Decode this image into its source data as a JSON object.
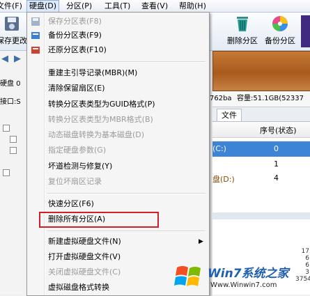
{
  "menubar": {
    "items": [
      {
        "label": "文件(F)"
      },
      {
        "label": "硬盘(D)"
      },
      {
        "label": "分区(P)"
      },
      {
        "label": "工具(T)"
      },
      {
        "label": "查看(V)"
      },
      {
        "label": "帮助(H)"
      }
    ]
  },
  "toolbar": {
    "save_label": "保存更改",
    "delete_partition_label": "删除分区",
    "backup_partition_label": "备份分区"
  },
  "left_panel": {
    "disk_label": "硬盘 0",
    "interface_label": "接口:S"
  },
  "disk_info": {
    "text": "762ba",
    "capacity": "容量:51.1GB(52337"
  },
  "tabs": {
    "file_tab": "文件"
  },
  "table": {
    "headers": {
      "serial": "序号(状态)"
    },
    "rows": [
      {
        "name": "(C:)",
        "serial": "0"
      },
      {
        "name": "",
        "serial": "1"
      },
      {
        "name": "盘(D:)",
        "serial": "4"
      }
    ]
  },
  "menu": {
    "items": [
      {
        "label": "保存分区表(F8)",
        "disabled": true
      },
      {
        "label": "备份分区表(F9)",
        "disabled": false
      },
      {
        "label": "还原分区表(F10)",
        "disabled": false
      },
      {
        "label": "重建主引导记录(MBR)(M)",
        "disabled": false
      },
      {
        "label": "清除保留扇区(E)",
        "disabled": false
      },
      {
        "label": "转换分区表类型为GUID格式(P)",
        "disabled": false
      },
      {
        "label": "转换分区表类型为MBR格式(B)",
        "disabled": true
      },
      {
        "label": "动态磁盘转换为基本磁盘(D)",
        "disabled": true
      },
      {
        "label": "指定硬盘参数(G)",
        "disabled": true
      },
      {
        "label": "坏道检测与修复(Y)",
        "disabled": false
      },
      {
        "label": "复位坏扇区记录",
        "disabled": true
      },
      {
        "label": "快速分区(F6)",
        "disabled": false
      },
      {
        "label": "删除所有分区(A)",
        "disabled": false
      },
      {
        "label": "新建虚拟硬盘文件(N)",
        "disabled": false
      },
      {
        "label": "打开虚拟硬盘文件(V)",
        "disabled": false
      },
      {
        "label": "关闭虚拟硬盘文件(C)",
        "disabled": true
      },
      {
        "label": "虚拟磁盘格式转换",
        "disabled": false
      }
    ]
  },
  "watermark": {
    "brand": "Win7系统之家",
    "url": "Www.Winwin7.com"
  },
  "side_numbers": [
    "17",
    "6",
    "6",
    "3",
    "3754"
  ]
}
